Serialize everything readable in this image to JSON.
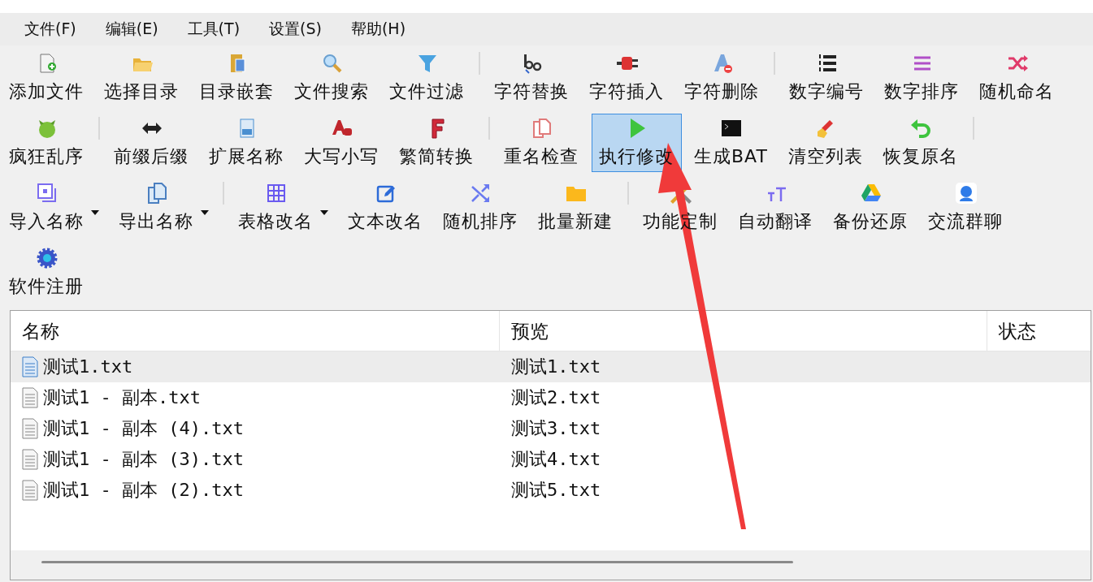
{
  "menu": [
    "文件(F)",
    "编辑(E)",
    "工具(T)",
    "设置(S)",
    "帮助(H)"
  ],
  "toolbar": {
    "rows": [
      {
        "items": [
          {
            "kind": "button",
            "label": "添加文件",
            "selected": false,
            "dropdown": false
          },
          {
            "kind": "button",
            "label": "选择目录",
            "selected": false,
            "dropdown": false
          },
          {
            "kind": "button",
            "label": "目录嵌套",
            "selected": false,
            "dropdown": false
          },
          {
            "kind": "button",
            "label": "文件搜索",
            "selected": false,
            "dropdown": false
          },
          {
            "kind": "button",
            "label": "文件过滤",
            "selected": false,
            "dropdown": false
          },
          {
            "kind": "separator"
          },
          {
            "kind": "button",
            "label": "字符替换",
            "selected": false,
            "dropdown": false
          },
          {
            "kind": "button",
            "label": "字符插入",
            "selected": false,
            "dropdown": false
          },
          {
            "kind": "button",
            "label": "字符删除",
            "selected": false,
            "dropdown": false
          },
          {
            "kind": "separator"
          },
          {
            "kind": "button",
            "label": "数字编号",
            "selected": false,
            "dropdown": false
          },
          {
            "kind": "button",
            "label": "数字排序",
            "selected": false,
            "dropdown": false
          },
          {
            "kind": "button",
            "label": "随机命名",
            "selected": false,
            "dropdown": false
          }
        ]
      },
      {
        "items": [
          {
            "kind": "button",
            "label": "疯狂乱序",
            "selected": false,
            "dropdown": false
          },
          {
            "kind": "separator"
          },
          {
            "kind": "button",
            "label": "前缀后缀",
            "selected": false,
            "dropdown": false
          },
          {
            "kind": "button",
            "label": "扩展名称",
            "selected": false,
            "dropdown": false
          },
          {
            "kind": "button",
            "label": "大写小写",
            "selected": false,
            "dropdown": false
          },
          {
            "kind": "button",
            "label": "繁简转换",
            "selected": false,
            "dropdown": false
          },
          {
            "kind": "separator"
          },
          {
            "kind": "button",
            "label": "重名检查",
            "selected": false,
            "dropdown": false
          },
          {
            "kind": "button",
            "label": "执行修改",
            "selected": true,
            "dropdown": false
          },
          {
            "kind": "button",
            "label": "生成BAT",
            "selected": false,
            "dropdown": false
          },
          {
            "kind": "button",
            "label": "清空列表",
            "selected": false,
            "dropdown": false
          },
          {
            "kind": "button",
            "label": "恢复原名",
            "selected": false,
            "dropdown": false
          },
          {
            "kind": "separator"
          }
        ]
      },
      {
        "items": [
          {
            "kind": "button",
            "label": "导入名称",
            "selected": false,
            "dropdown": true
          },
          {
            "kind": "button",
            "label": "导出名称",
            "selected": false,
            "dropdown": true
          },
          {
            "kind": "separator"
          },
          {
            "kind": "button",
            "label": "表格改名",
            "selected": false,
            "dropdown": true
          },
          {
            "kind": "button",
            "label": "文本改名",
            "selected": false,
            "dropdown": false
          },
          {
            "kind": "button",
            "label": "随机排序",
            "selected": false,
            "dropdown": false
          },
          {
            "kind": "button",
            "label": "批量新建",
            "selected": false,
            "dropdown": false
          },
          {
            "kind": "separator"
          },
          {
            "kind": "button",
            "label": "功能定制",
            "selected": false,
            "dropdown": false
          },
          {
            "kind": "button",
            "label": "自动翻译",
            "selected": false,
            "dropdown": false
          },
          {
            "kind": "button",
            "label": "备份还原",
            "selected": false,
            "dropdown": false
          },
          {
            "kind": "button",
            "label": "交流群聊",
            "selected": false,
            "dropdown": false
          }
        ]
      },
      {
        "items": [
          {
            "kind": "button",
            "label": "软件注册",
            "selected": false,
            "dropdown": false
          }
        ]
      }
    ]
  },
  "file_list": {
    "columns": [
      "名称",
      "预览",
      "状态"
    ],
    "rows": [
      {
        "name": "测试1.txt",
        "preview": "测试1.txt",
        "selected": true
      },
      {
        "name": "测试1 - 副本.txt",
        "preview": "测试2.txt",
        "selected": false
      },
      {
        "name": "测试1 - 副本 (4).txt",
        "preview": "测试3.txt",
        "selected": false
      },
      {
        "name": "测试1 - 副本 (3).txt",
        "preview": "测试4.txt",
        "selected": false
      },
      {
        "name": "测试1 - 副本 (2).txt",
        "preview": "测试5.txt",
        "selected": false
      }
    ]
  }
}
